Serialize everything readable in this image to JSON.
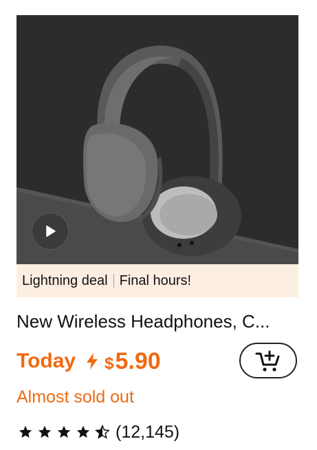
{
  "product": {
    "image_icon": "headphones-image",
    "play_icon": "play-icon",
    "banner": {
      "deal_label": "Lightning deal",
      "urgency_label": "Final hours!"
    },
    "title": "New Wireless Headphones, C...",
    "price": {
      "prefix": "Today",
      "currency": "$",
      "amount": "5.90",
      "bolt_icon": "lightning-bolt-icon"
    },
    "cart_icon": "add-to-cart-icon",
    "stock_status": "Almost sold out",
    "rating": {
      "value": 4.5,
      "out_of": 5,
      "count_label": "(12,145)"
    }
  },
  "colors": {
    "accent": "#f06a12",
    "banner_bg": "#fdeee2",
    "image_bg": "#2b2b2b"
  }
}
